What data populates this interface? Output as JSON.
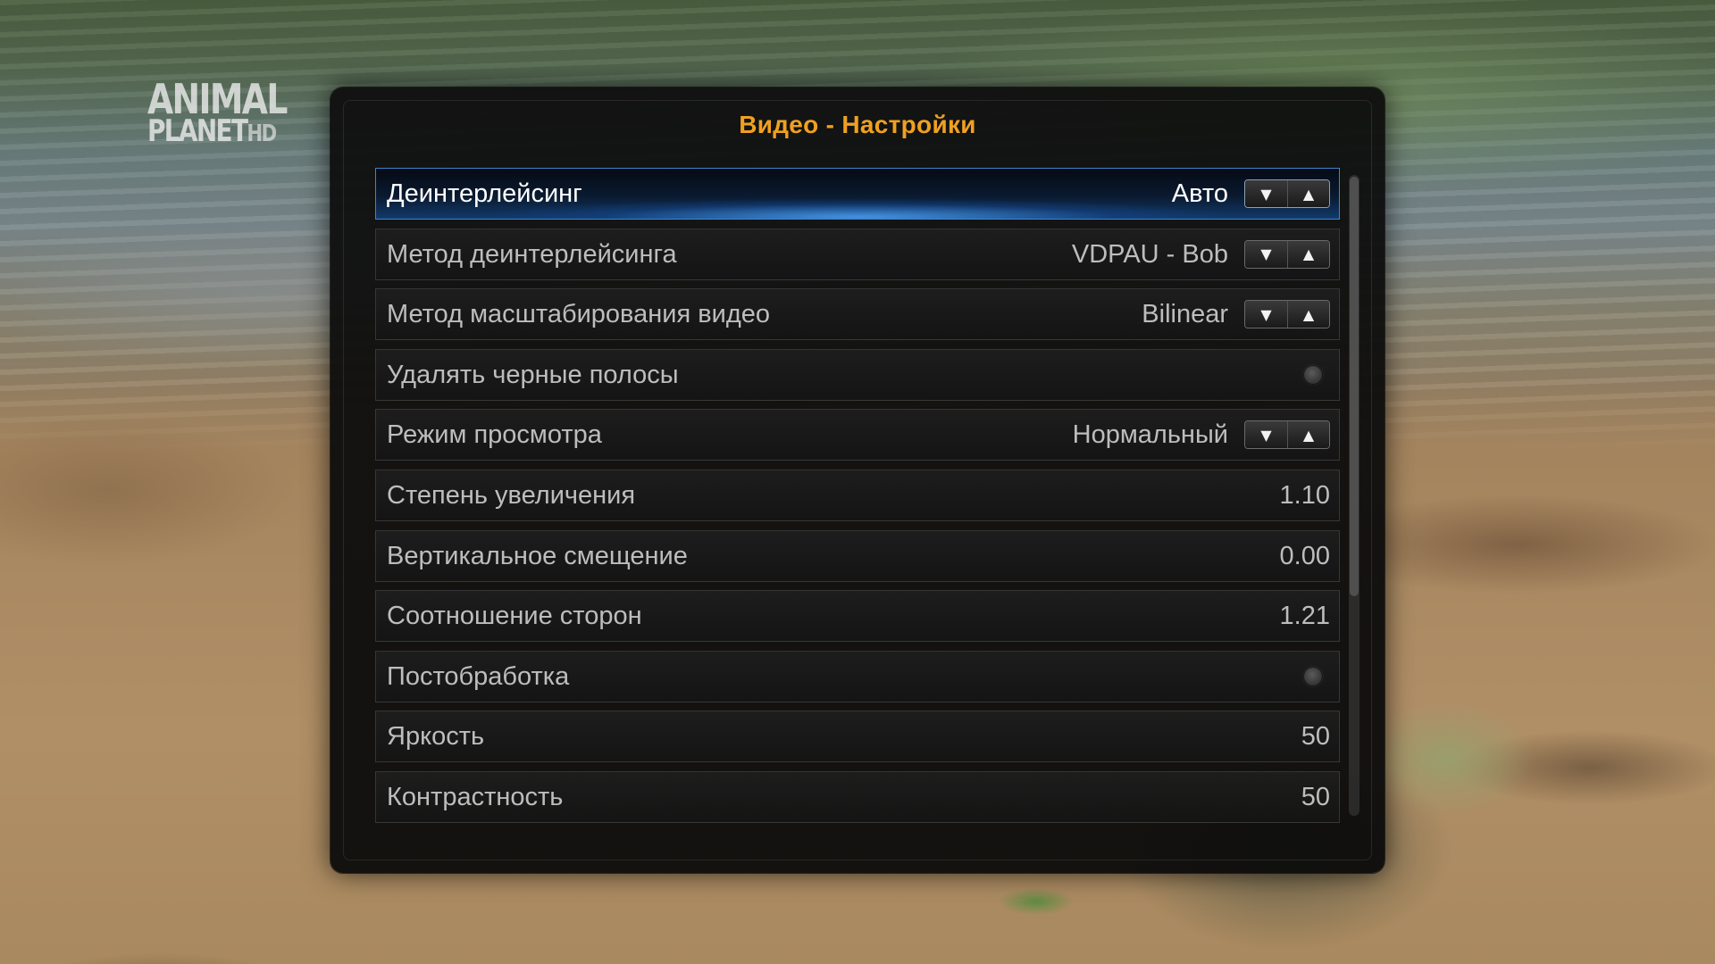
{
  "overlay": {
    "logo_line1": "ANIMAL",
    "logo_line2": "PLANET",
    "logo_hd": "HD"
  },
  "dialog": {
    "title": "Видео - Настройки"
  },
  "settings": [
    {
      "label": "Деинтерлейсинг",
      "value": "Авто",
      "control": "spinner",
      "focused": true
    },
    {
      "label": "Метод деинтерлейсинга",
      "value": "VDPAU - Bob",
      "control": "spinner"
    },
    {
      "label": "Метод масштабирования видео",
      "value": "Bilinear",
      "control": "spinner"
    },
    {
      "label": "Удалять черные полосы",
      "value": "",
      "control": "radio",
      "checked": false
    },
    {
      "label": "Режим просмотра",
      "value": "Нормальный",
      "control": "spinner"
    },
    {
      "label": "Степень увеличения",
      "value": "1.10",
      "control": "slider-value"
    },
    {
      "label": "Вертикальное смещение",
      "value": "0.00",
      "control": "slider-value"
    },
    {
      "label": "Соотношение сторон",
      "value": "1.21",
      "control": "slider-value"
    },
    {
      "label": "Постобработка",
      "value": "",
      "control": "radio",
      "checked": false
    },
    {
      "label": "Яркость",
      "value": "50",
      "control": "slider-value"
    },
    {
      "label": "Контрастность",
      "value": "50",
      "control": "slider-value"
    }
  ],
  "spinner": {
    "down_icon": "▼",
    "up_icon": "▲"
  },
  "colors": {
    "title": "#f0a020",
    "focus_border": "#3c86d0",
    "label": "#bdbdbd"
  }
}
